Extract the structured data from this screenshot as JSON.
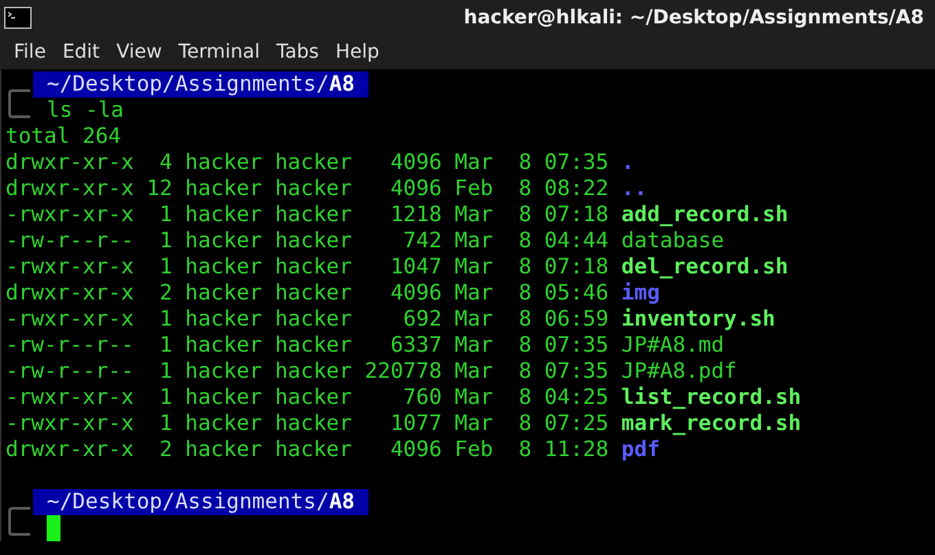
{
  "window": {
    "title": "hacker@hlkali: ~/Desktop/Assignments/A8"
  },
  "menu": [
    "File",
    "Edit",
    "View",
    "Terminal",
    "Tabs",
    "Help"
  ],
  "terminal": {
    "blocks": [
      {
        "kind": "prompt",
        "path": "~/Desktop/Assignments/**A8**",
        "command": "ls -la"
      },
      {
        "kind": "listing",
        "total": "total 264",
        "entries": [
          {
            "details": "drwxr-xr-x  4 hacker hacker   4096 Mar  8 07:35",
            "name": ".",
            "kind": "dir"
          },
          {
            "details": "drwxr-xr-x 12 hacker hacker   4096 Feb  8 08:22",
            "name": "..",
            "kind": "dir"
          },
          {
            "details": "-rwxr-xr-x  1 hacker hacker   1218 Mar  8 07:18",
            "name": "add_record.sh",
            "kind": "exec"
          },
          {
            "details": "-rw-r--r--  1 hacker hacker    742 Mar  8 04:44",
            "name": "database",
            "kind": "file"
          },
          {
            "details": "-rwxr-xr-x  1 hacker hacker   1047 Mar  8 07:18",
            "name": "del_record.sh",
            "kind": "exec"
          },
          {
            "details": "drwxr-xr-x  2 hacker hacker   4096 Mar  8 05:46",
            "name": "img",
            "kind": "dir"
          },
          {
            "details": "-rwxr-xr-x  1 hacker hacker    692 Mar  8 06:59",
            "name": "inventory.sh",
            "kind": "exec"
          },
          {
            "details": "-rw-r--r--  1 hacker hacker   6337 Mar  8 07:35",
            "name": "JP#A8.md",
            "kind": "file"
          },
          {
            "details": "-rw-r--r--  1 hacker hacker 220778 Mar  8 07:35",
            "name": "JP#A8.pdf",
            "kind": "file"
          },
          {
            "details": "-rwxr-xr-x  1 hacker hacker    760 Mar  8 04:25",
            "name": "list_record.sh",
            "kind": "exec"
          },
          {
            "details": "-rwxr-xr-x  1 hacker hacker   1077 Mar  8 07:25",
            "name": "mark_record.sh",
            "kind": "exec"
          },
          {
            "details": "drwxr-xr-x  2 hacker hacker   4096 Feb  8 11:28",
            "name": "pdf",
            "kind": "dir"
          }
        ]
      },
      {
        "kind": "prompt",
        "path": "~/Desktop/Assignments/**A8**",
        "cursor": true
      }
    ]
  }
}
